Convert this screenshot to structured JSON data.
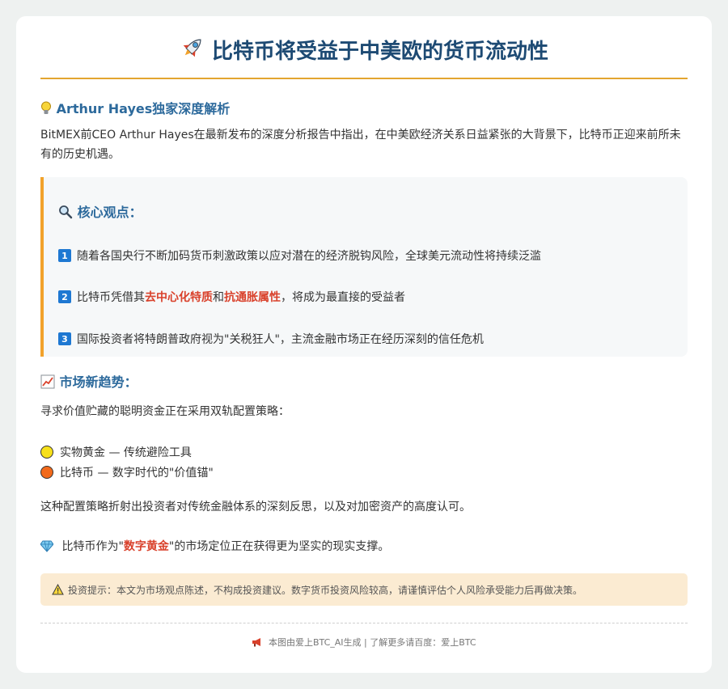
{
  "title": {
    "icon": "rocket-icon",
    "text": "比特币将受益于中美欧的货币流动性"
  },
  "analysis": {
    "icon": "lightbulb-icon",
    "heading": "Arthur Hayes独家深度解析",
    "intro": "BitMEX前CEO Arthur Hayes在最新发布的深度分析报告中指出，在中美欧经济关系日益紧张的大背景下，比特币正迎来前所未有的历史机遇。"
  },
  "core": {
    "icon": "magnifier-icon",
    "heading": "核心观点：",
    "points": [
      {
        "num": "1",
        "text": "随着各国央行不断加码货币刺激政策以应对潜在的经济脱钩风险，全球美元流动性将持续泛滥"
      },
      {
        "num": "2",
        "before": "比特币凭借其",
        "hl1": "去中心化特质",
        "mid": "和",
        "hl2": "抗通胀属性",
        "after": "，将成为最直接的受益者"
      },
      {
        "num": "3",
        "text": "国际投资者将特朗普政府视为\"关税狂人\"，主流金融市场正在经历深刻的信任危机"
      }
    ]
  },
  "trend": {
    "icon": "chart-up-icon",
    "heading": "市场新趋势：",
    "intro": "寻求价值贮藏的聪明资金正在采用双轨配置策略：",
    "items": [
      {
        "icon": "yellow-circle-icon",
        "color": "#f7e01a",
        "text": "实物黄金 — 传统避险工具"
      },
      {
        "icon": "orange-circle-icon",
        "color": "#f26a1b",
        "text": "比特币 — 数字时代的\"价值锚\""
      }
    ],
    "reflection": "这种配置策略折射出投资者对传统金融体系的深刻反思，以及对加密资产的高度认可。",
    "gem": {
      "icon": "gem-icon",
      "before": "比特币作为\"",
      "hl": "数字黄金",
      "after": "\"的市场定位正在获得更为坚实的现实支撑。"
    }
  },
  "notice": {
    "icon": "warning-icon",
    "text": "投资提示：本文为市场观点陈述，不构成投资建议。数字货币投资风险较高，请谨慎评估个人风险承受能力后再做决策。"
  },
  "footer": {
    "icon": "megaphone-icon",
    "text": "本图由爱上BTC_AI生成 | 了解更多请百度：爱上BTC"
  },
  "colors": {
    "title": "#1d4a73",
    "heading": "#2d6a9c",
    "accent": "#f2a22b",
    "highlight": "#d9412b",
    "notice_bg": "#fbebd2",
    "number_badge": "#1e78d2"
  }
}
